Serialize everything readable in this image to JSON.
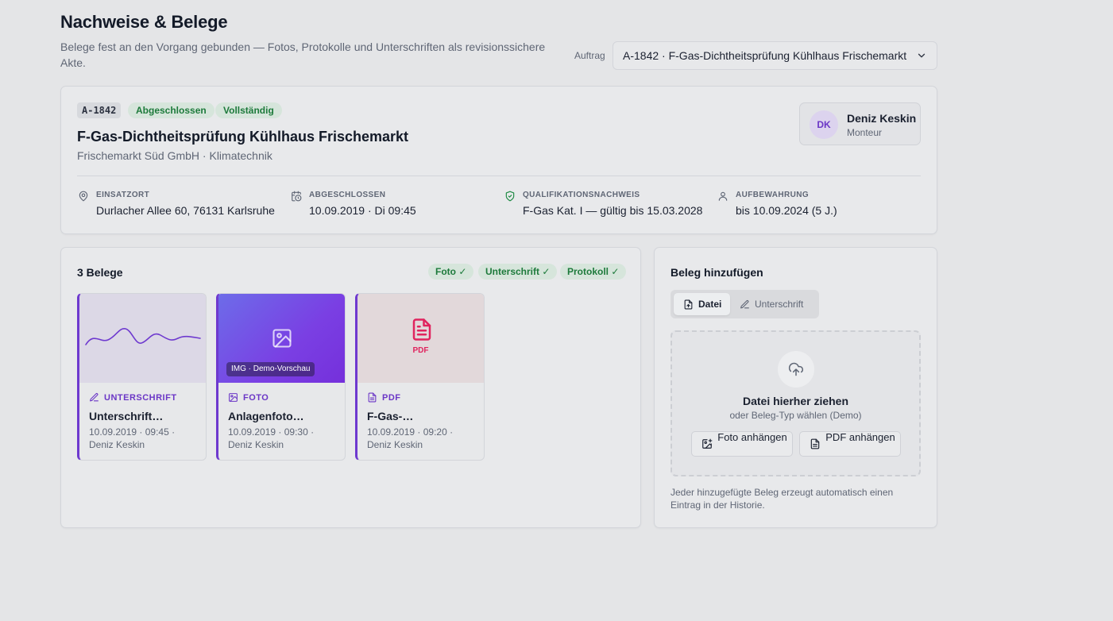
{
  "header": {
    "title": "Nachweise & Belege",
    "subtitle": "Belege fest an den Vorgang gebunden — Fotos, Protokolle und Unterschriften als revisionssichere Akte.",
    "order_label": "Auftrag",
    "order_selected": "A-1842 · F-Gas-Dichtheitsprüfung Kühlhaus Frischemarkt"
  },
  "order": {
    "code": "A-1842",
    "status_badges": [
      "Abgeschlossen",
      "Vollständig"
    ],
    "title": "F-Gas-Dichtheitsprüfung Kühlhaus Frischemarkt",
    "customer": "Frischemarkt Süd GmbH · Klimatechnik",
    "technician": {
      "initials": "DK",
      "name": "Deniz Keskin",
      "role": "Monteur"
    },
    "meta": [
      {
        "icon": "map-pin-icon",
        "label": "EINSATZORT",
        "value": "Durlacher Allee 60, 76131 Karlsruhe"
      },
      {
        "icon": "calendar-clock-icon",
        "label": "ABGESCHLOSSEN",
        "value": "10.09.2019 · Di 09:45"
      },
      {
        "icon": "shield-check-icon",
        "label": "QUALIFIKATIONSNACHWEIS",
        "value": "F-Gas Kat. I — gültig bis 15.03.2028"
      },
      {
        "icon": "user-icon",
        "label": "AUFBEWAHRUNG",
        "value": "bis 10.09.2024 (5 J.)"
      }
    ]
  },
  "documents": {
    "title": "3 Belege",
    "checks": [
      "Foto ✓",
      "Unterschrift ✓",
      "Protokoll ✓"
    ],
    "items": [
      {
        "type": "UNTERSCHRIFT",
        "icon": "pen-icon",
        "name": "Unterschrift…",
        "info": "10.09.2019 · 09:45 · Deniz Keskin"
      },
      {
        "type": "FOTO",
        "icon": "image-icon",
        "name": "Anlagenfoto…",
        "info": "10.09.2019 · 09:30 · Deniz Keskin",
        "badge": "IMG · Demo-Vorschau"
      },
      {
        "type": "PDF",
        "icon": "file-text-icon",
        "name": "F-Gas-…",
        "info": "10.09.2019 · 09:20 · Deniz Keskin",
        "thumb_label": "PDF"
      }
    ]
  },
  "add": {
    "title": "Beleg hinzufügen",
    "tabs": [
      "Datei",
      "Unterschrift"
    ],
    "drop_title": "Datei hierher ziehen",
    "drop_sub": "oder Beleg-Typ wählen (Demo)",
    "btn_photo": "Foto anhängen",
    "btn_pdf": "PDF anhängen",
    "note": "Jeder hinzugefügte Beleg erzeugt automatisch einen Eintrag in der Historie."
  },
  "colors": {
    "accent": "#6e39cf",
    "success": "#1d7a3b",
    "pdf": "#e0245e"
  }
}
